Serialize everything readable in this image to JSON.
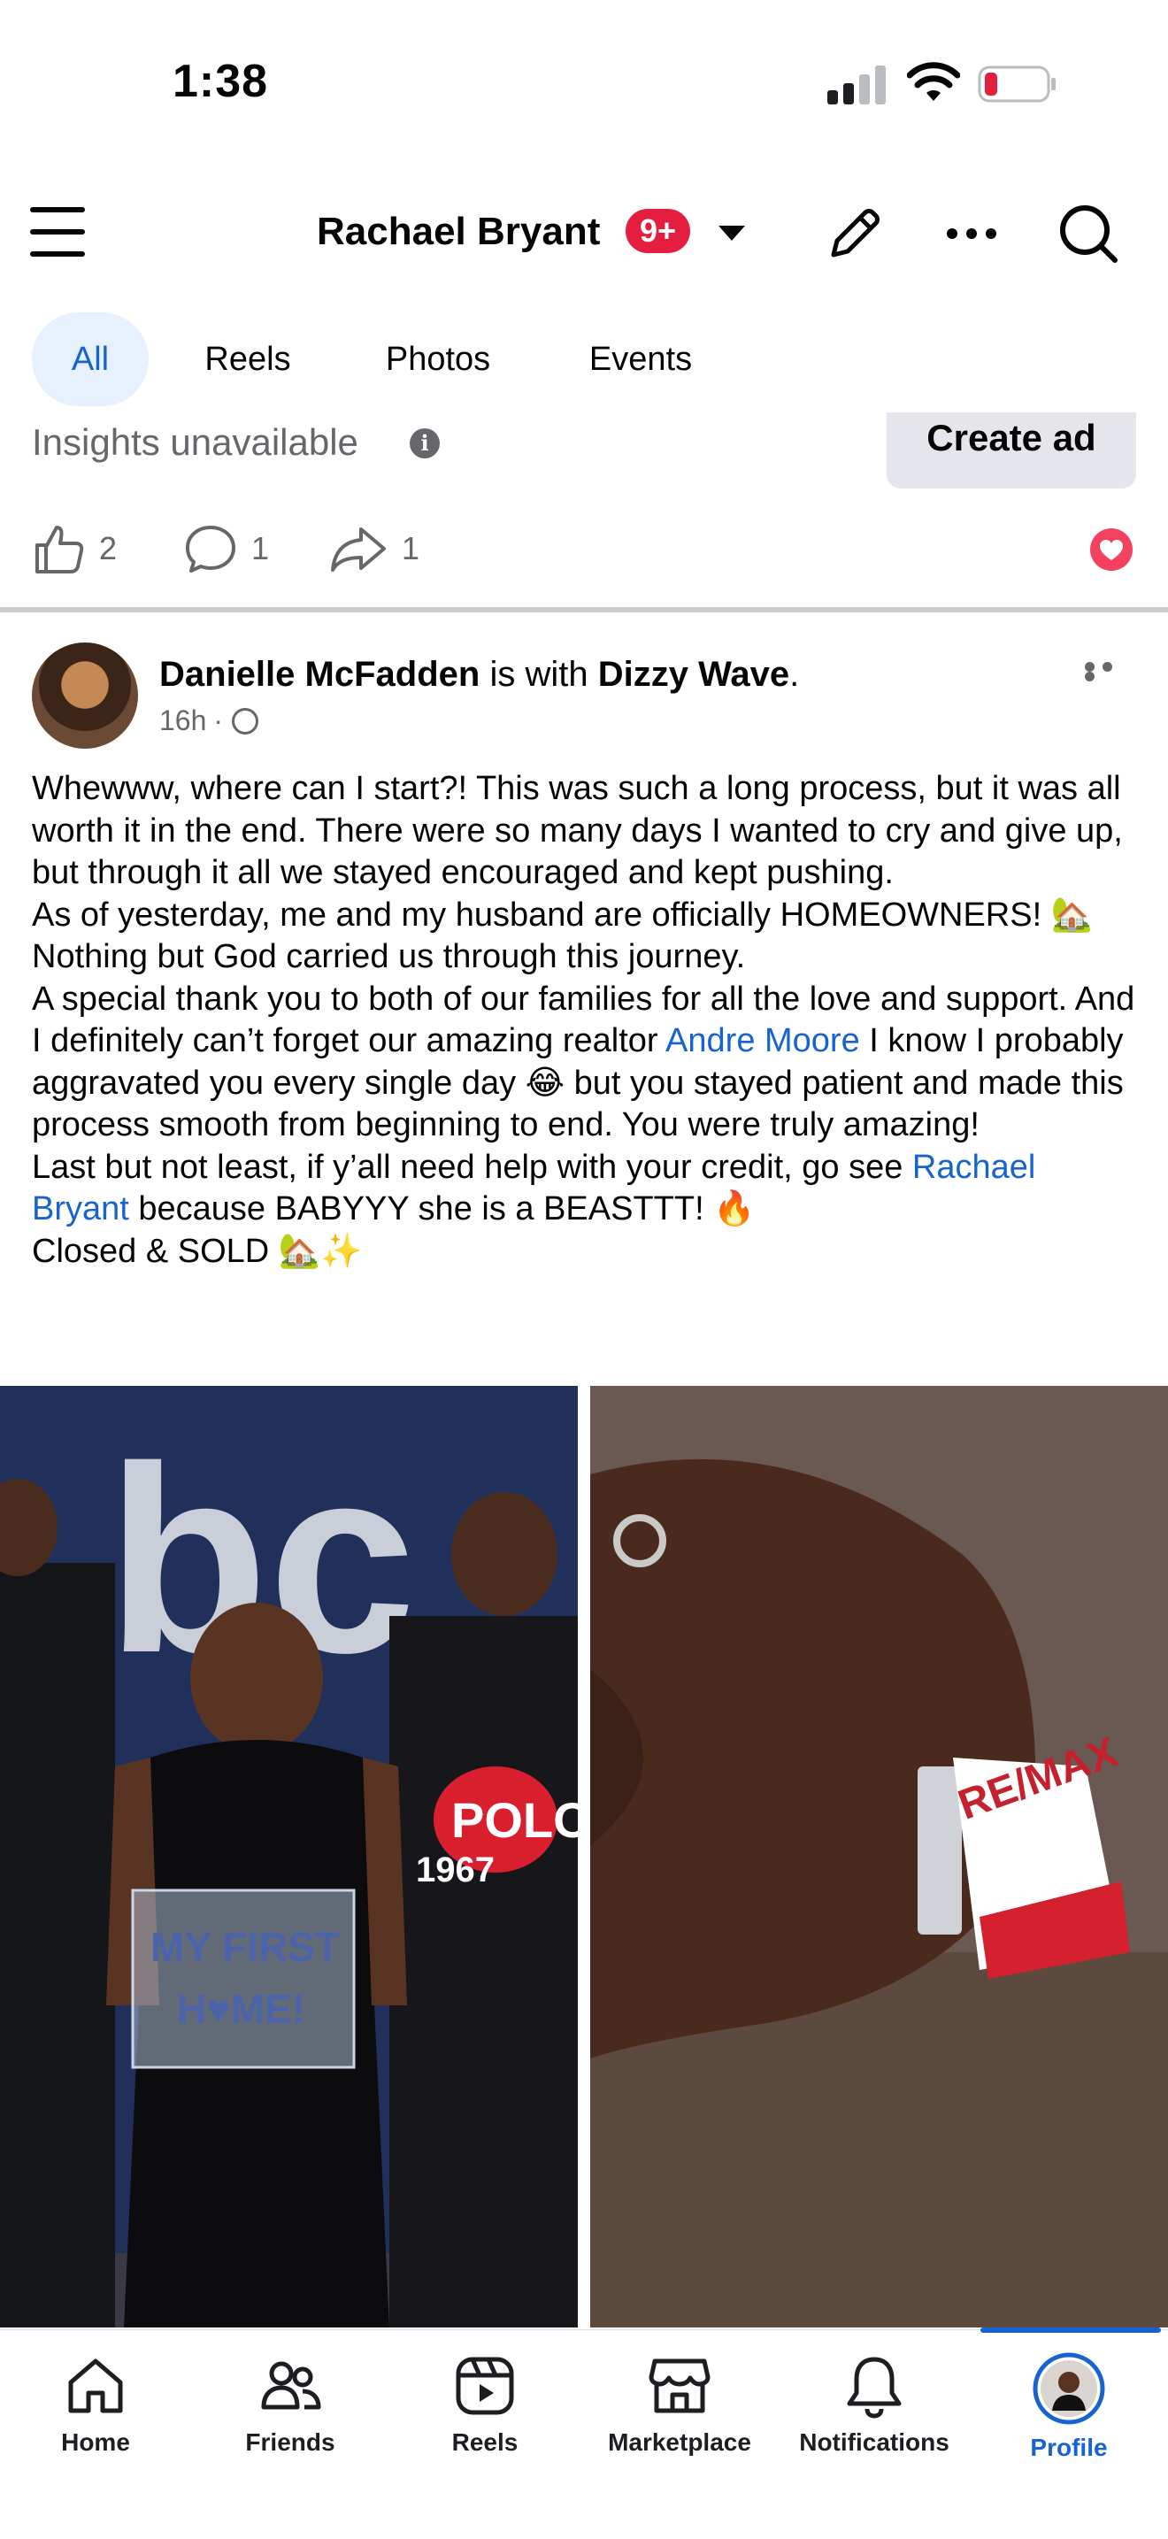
{
  "status_bar": {
    "time": "1:38"
  },
  "header": {
    "page_name": "Rachael Bryant",
    "notification_badge": "9+"
  },
  "filter_tabs": [
    {
      "label": "All",
      "active": true
    },
    {
      "label": "Reels",
      "active": false
    },
    {
      "label": "Photos",
      "active": false
    },
    {
      "label": "Events",
      "active": false
    }
  ],
  "previous_post": {
    "insights_text": "Insights unavailable",
    "create_ad_label": "Create ad",
    "likes": "2",
    "comments": "1",
    "shares": "1"
  },
  "post": {
    "author": "Danielle McFadden",
    "with_text": "is with",
    "tagged": "Dizzy Wave",
    "time": "16h",
    "p1": "Whewww, where can I start?! This was such a long process, but it was all worth it in the end. There were so many days I wanted to cry and give up, but through it all we stayed encouraged and kept pushing.",
    "p2": "As of yesterday, me and my husband are officially HOMEOWNERS! 🏡 Nothing but God carried us through this journey.",
    "p3_before": "A special thank you to both of our families for all the love and support. And I definitely can’t forget our amazing realtor ",
    "p3_link": "Andre Moore",
    "p3_after": "  I know I probably aggravated you every single day 😂 but you stayed patient and made this process smooth from beginning to end. You were truly amazing!",
    "p4_before": "Last but not least, if y’all need help with your credit, go see ",
    "p4_link": "Rachael Bryant",
    "p4_after": " because BABYYY she is a BEASTTT! 🔥",
    "p5": "Closed & SOLD 🏡✨",
    "photo1": {
      "logo": "bc",
      "sign_line1": "MY FIRST",
      "sign_line2": "H♥ME!",
      "shirt": "POLO",
      "shirt_year": "1967"
    },
    "photo2": {
      "keychain": "RE/MAX"
    }
  },
  "bottom_nav": [
    {
      "label": "Home",
      "icon": "home-icon"
    },
    {
      "label": "Friends",
      "icon": "friends-icon"
    },
    {
      "label": "Reels",
      "icon": "reels-icon"
    },
    {
      "label": "Marketplace",
      "icon": "marketplace-icon"
    },
    {
      "label": "Notifications",
      "icon": "bell-icon"
    },
    {
      "label": "Profile",
      "icon": "profile-avatar"
    }
  ],
  "colors": {
    "accent": "#1763cf",
    "badge": "#e41e3f",
    "heart": "#f3425f",
    "muted": "#65676b"
  }
}
